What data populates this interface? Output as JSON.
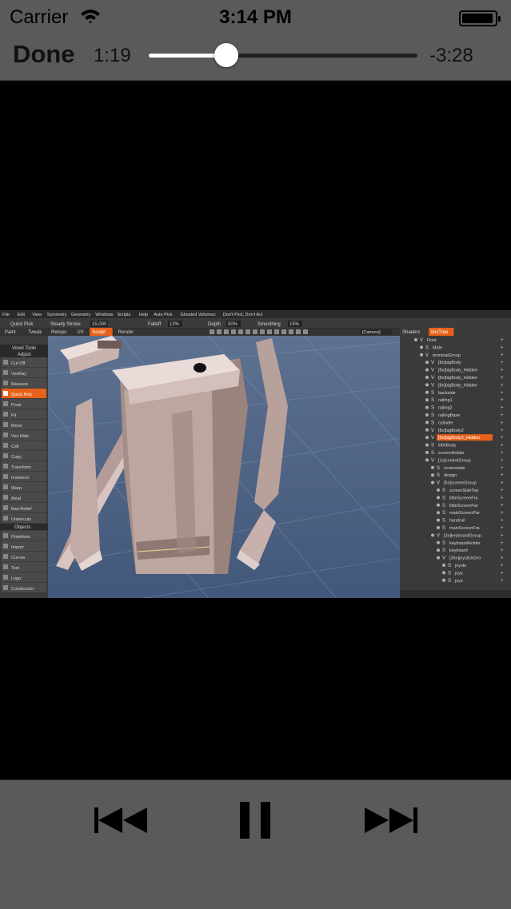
{
  "status_bar": {
    "carrier": "Carrier",
    "time": "3:14 PM"
  },
  "player": {
    "done_label": "Done",
    "elapsed": "1:19",
    "remaining": "-3:28",
    "progress": 0.29
  },
  "video_frame": {
    "menu_items": [
      "File",
      "Edit",
      "View",
      "Symmetry",
      "Geometry",
      "Windows",
      "Scripts",
      "Help",
      "Auto Pick",
      "Ghosted Volumes:",
      "Don't Pick, Don't Act"
    ],
    "toolbar": {
      "quick_pick": "Quick Pick",
      "steady_stroke": "Steady Stroke",
      "steady_value": "15.000",
      "falloff": "Falloff",
      "falloff_value": "13%",
      "depth": "Depth",
      "depth_value": "50%",
      "smoothing": "Smoothing",
      "smoothing_value": "15%",
      "camera": "[Camera]"
    },
    "tabs": [
      "Paint",
      "Tweak",
      "Retopo",
      "UV",
      "Sculpt",
      "Render"
    ],
    "active_tab": "Sculpt",
    "panel_tabs": [
      "Shaders",
      "VoxTree"
    ],
    "active_panel_tab": "VoxTree",
    "tool_headers": {
      "top": "Voxel Tools",
      "adjust": "Adjust",
      "objects": "Objects"
    },
    "tools": [
      "Cut Off",
      "VoxRay",
      "Measure",
      "Quick Pick",
      "Pose",
      "Fit",
      "Move",
      "Vox Hide",
      "Cell",
      "Copy",
      "Transform",
      "Instancer",
      "Warp",
      "Axial",
      "Bas-Relief",
      "Undercuts"
    ],
    "active_tool": "Quick Pick",
    "object_tools": [
      "Primitives",
      "Import",
      "Curves",
      "Text",
      "Logo",
      "Constructor"
    ],
    "tree_items": [
      {
        "mark": "V",
        "label": "Root",
        "level": 0
      },
      {
        "mark": "S",
        "label": "Male",
        "level": 1
      },
      {
        "mark": "V",
        "label": "terminalGroup",
        "level": 1
      },
      {
        "mark": "V",
        "label": "[8x]bigBody",
        "level": 2
      },
      {
        "mark": "V",
        "label": "[8x]bigBody_Hidden",
        "level": 2
      },
      {
        "mark": "V",
        "label": "[8x]bigBody_Hidden",
        "level": 2
      },
      {
        "mark": "V",
        "label": "[8x]bigBody_Hidden",
        "level": 2
      },
      {
        "mark": "S",
        "label": "backside",
        "level": 2
      },
      {
        "mark": "S",
        "label": "railing1",
        "level": 2
      },
      {
        "mark": "S",
        "label": "railing2",
        "level": 2
      },
      {
        "mark": "S",
        "label": "railingBase",
        "level": 2
      },
      {
        "mark": "S",
        "label": "cylinder",
        "level": 2
      },
      {
        "mark": "V",
        "label": "[8x]bigBody2",
        "level": 2
      },
      {
        "mark": "V",
        "label": "[8x]bigBody2_Hidden",
        "level": 2,
        "selected": true
      },
      {
        "mark": "S",
        "label": "littleBody",
        "level": 2
      },
      {
        "mark": "S",
        "label": "screenHolder",
        "level": 2
      },
      {
        "mark": "V",
        "label": "[1x]controlGroup",
        "level": 2
      },
      {
        "mark": "S",
        "label": "screenside",
        "level": 3
      },
      {
        "mark": "S",
        "label": "design",
        "level": 3
      },
      {
        "mark": "V",
        "label": "[5x]screenGroup",
        "level": 3
      },
      {
        "mark": "S",
        "label": "screenSideTop",
        "level": 4
      },
      {
        "mark": "S",
        "label": "littleScreenFra",
        "level": 4
      },
      {
        "mark": "S",
        "label": "littleScreenPar",
        "level": 4
      },
      {
        "mark": "S",
        "label": "mainScreenPar",
        "level": 4
      },
      {
        "mark": "S",
        "label": "handrail",
        "level": 4
      },
      {
        "mark": "S",
        "label": "mainScreenFra",
        "level": 4
      },
      {
        "mark": "V",
        "label": "[3x]keyboardGroup",
        "level": 3
      },
      {
        "mark": "S",
        "label": "keyboardHolder",
        "level": 4
      },
      {
        "mark": "S",
        "label": "keyboard",
        "level": 4
      },
      {
        "mark": "V",
        "label": "[36x]joystickGro",
        "level": 4
      },
      {
        "mark": "S",
        "label": "joyste",
        "level": 5
      },
      {
        "mark": "S",
        "label": "joys",
        "level": 5
      },
      {
        "mark": "S",
        "label": "joys",
        "level": 5
      }
    ]
  },
  "colors": {
    "bar_bg": "#5a5a5a",
    "track_played": "#ffffff",
    "track_remaining": "#202020",
    "app_accent": "#e8611a",
    "viewport_bg": "#4f6584"
  },
  "icons": {
    "wifi": "wifi-icon",
    "battery": "battery-icon",
    "previous": "skip-back-icon",
    "pause": "pause-icon",
    "next": "skip-forward-icon"
  }
}
